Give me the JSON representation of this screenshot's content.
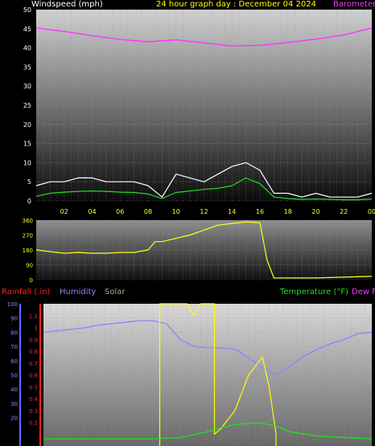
{
  "header": {
    "windspeed_label": "Windspeed (mph)",
    "title": "24 hour graph day : December 04 2024",
    "barometer_label": "Barometer"
  },
  "legend": {
    "rainfall": "Rainfall (.in)",
    "humidity": "Humidity",
    "solar": "Solar",
    "temperature": "Temperature (°F)",
    "dew": "Dew F"
  },
  "colors": {
    "windspeed": "#ffffff",
    "gust": "#ffffff",
    "avg_wind": "#22dd22",
    "barometer": "#ff33ff",
    "direction": "#ffff22",
    "rainfall": "#ff2222",
    "humidity": "#8888ff",
    "solar": "#ffff00",
    "temperature": "#22dd22",
    "dew": "#ff33ff",
    "title": "#ffff00",
    "axis_text": "#ffffff"
  },
  "chart_data": [
    {
      "type": "line",
      "name": "wind-chart",
      "x_ticks": [
        "02",
        "04",
        "06",
        "08",
        "10",
        "12",
        "14",
        "16",
        "18",
        "20",
        "22",
        "00"
      ],
      "ylim": [
        0,
        50
      ],
      "y_ticks": [
        0,
        5,
        10,
        15,
        20,
        25,
        30,
        35,
        40,
        45,
        50
      ],
      "series": [
        {
          "key": "barometer",
          "color": "#ff33ff",
          "x": [
            0,
            2,
            4,
            6,
            8,
            10,
            12,
            14,
            16,
            18,
            20,
            22,
            24
          ],
          "y": [
            45.2,
            44.3,
            43.2,
            42.2,
            41.6,
            42.1,
            41.3,
            40.5,
            40.7,
            41.4,
            42.3,
            43.4,
            45.2
          ]
        },
        {
          "key": "windspeed",
          "color": "#ffffff",
          "x": [
            0,
            1,
            2,
            3,
            4,
            5,
            6,
            7,
            8,
            9,
            10,
            11,
            12,
            13,
            14,
            15,
            16,
            17,
            18,
            19,
            20,
            21,
            22,
            23,
            24
          ],
          "y": [
            4,
            5,
            5,
            6,
            6,
            5,
            5,
            5,
            4,
            1,
            7,
            6,
            5,
            7,
            9,
            10,
            8,
            2,
            2,
            1,
            2,
            1,
            1,
            1,
            2
          ]
        },
        {
          "key": "avg_wind",
          "color": "#22dd22",
          "x": [
            0,
            1,
            2,
            3,
            4,
            5,
            6,
            7,
            8,
            9,
            10,
            11,
            12,
            13,
            14,
            15,
            16,
            17,
            18,
            19,
            20,
            21,
            22,
            23,
            24
          ],
          "y": [
            1.2,
            2,
            2.3,
            2.5,
            2.6,
            2.5,
            2.3,
            2.2,
            1.8,
            0.6,
            2.2,
            2.6,
            3.0,
            3.3,
            4.0,
            6.0,
            4.5,
            1.0,
            0.6,
            0.4,
            0.5,
            0.4,
            0.3,
            0.3,
            0.5
          ]
        }
      ]
    },
    {
      "type": "line",
      "name": "wind-direction-chart",
      "x_ticks": [],
      "ylim": [
        0,
        360
      ],
      "y_ticks": [
        0,
        90,
        180,
        270,
        360
      ],
      "series": [
        {
          "key": "direction",
          "color": "#ffff22",
          "x": [
            0,
            1,
            2,
            3,
            4,
            5,
            6,
            7,
            8,
            8.5,
            9,
            10,
            11,
            12,
            13,
            14,
            15,
            16,
            16.5,
            17,
            18,
            20,
            22,
            24
          ],
          "y": [
            180,
            170,
            160,
            165,
            160,
            160,
            165,
            165,
            180,
            230,
            230,
            250,
            270,
            300,
            330,
            340,
            350,
            345,
            120,
            10,
            10,
            10,
            15,
            20
          ]
        }
      ]
    },
    {
      "type": "line",
      "name": "rain-humidity-temp-chart",
      "humidity_ylim": [
        0,
        100
      ],
      "humidity_ticks": [
        20,
        30,
        40,
        50,
        60,
        70,
        80,
        90,
        100
      ],
      "rain_ylim": [
        0,
        1.2
      ],
      "rain_ticks": [
        "0.2",
        "0.3",
        "0.4",
        "0.5",
        "0.6",
        "0.7",
        "0.8",
        "0.9",
        "1",
        "1.1"
      ],
      "series": [
        {
          "key": "humidity",
          "color": "#8888ff",
          "x": [
            0,
            1,
            2,
            3,
            4,
            5,
            6,
            7,
            8,
            9,
            10,
            11,
            12,
            13,
            14,
            15,
            16,
            17,
            18,
            19,
            20,
            21,
            22,
            23,
            24
          ],
          "y": [
            80,
            81,
            82,
            83,
            85,
            86,
            87,
            88,
            88,
            86,
            75,
            70,
            69,
            69,
            68,
            62,
            55,
            50,
            56,
            63,
            68,
            72,
            75,
            79,
            80
          ]
        },
        {
          "key": "solar",
          "color": "#ffff00",
          "x": [
            8.5,
            8.5,
            10,
            10.5,
            11,
            11.5,
            12,
            12.5,
            12.5,
            13,
            14,
            15,
            16,
            16.5,
            17,
            17
          ],
          "y": [
            0,
            1.2,
            1.2,
            1.2,
            1.1,
            1.2,
            1.2,
            1.2,
            0.1,
            0.15,
            0.3,
            0.6,
            0.75,
            0.5,
            0.1,
            0
          ]
        },
        {
          "key": "temperature",
          "color": "#22dd22",
          "x": [
            0,
            2,
            4,
            6,
            8,
            10,
            12,
            13,
            14,
            15,
            16,
            17,
            18,
            20,
            22,
            24
          ],
          "y": [
            5,
            5,
            5,
            5,
            5,
            6,
            10,
            13,
            15,
            16,
            16,
            14,
            10,
            7,
            6,
            5
          ]
        }
      ]
    }
  ]
}
